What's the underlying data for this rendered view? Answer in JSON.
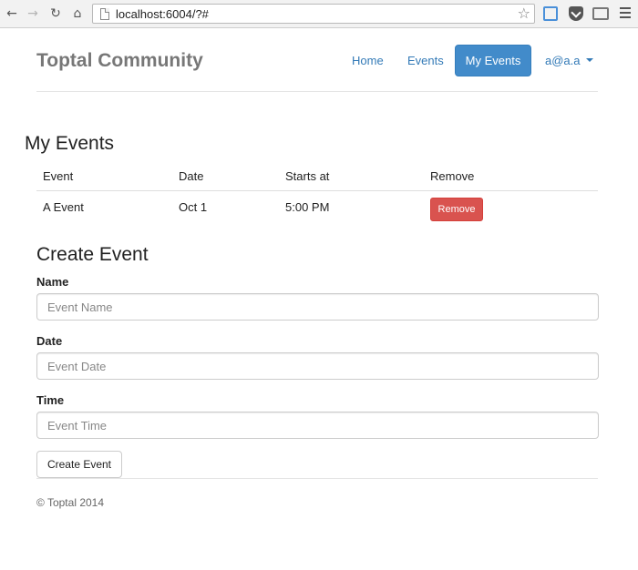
{
  "browser": {
    "url": "localhost:6004/?#",
    "back_icon": "arrow-left",
    "forward_icon": "arrow-right",
    "reload_icon": "reload",
    "home_icon": "home",
    "star_icon": "star"
  },
  "navbar": {
    "brand": "Toptal Community",
    "links": [
      "Home",
      "Events",
      "My Events"
    ],
    "active_link": "My Events",
    "user": "a@a.a",
    "accent_color": "#428bca"
  },
  "my_events": {
    "heading": "My Events",
    "columns": [
      "Event",
      "Date",
      "Starts at",
      "Remove"
    ],
    "rows": [
      {
        "event": "A Event",
        "date": "Oct 1",
        "starts_at": "5:00 PM",
        "remove_label": "Remove"
      }
    ]
  },
  "create_event": {
    "heading": "Create Event",
    "name_label": "Name",
    "name_placeholder": "Event Name",
    "date_label": "Date",
    "date_placeholder": "Event Date",
    "time_label": "Time",
    "time_placeholder": "Event Time",
    "submit_label": "Create Event"
  },
  "footer": {
    "text": "© Toptal 2014"
  }
}
